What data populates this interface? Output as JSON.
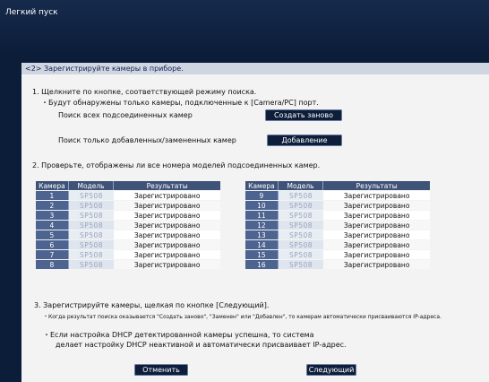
{
  "window": {
    "title": "Легкий пуск"
  },
  "section": {
    "header": "<2> Зарегистрируйте камеры в приборе."
  },
  "step1": {
    "heading": "1. Щелкните по кнопке, соответствующей режиму поиска.",
    "note": "・Будут обнаружены только камеры, подключенные к [Camera/PC] порт.",
    "search_all_label": "Поиск всех подсоединенных камер",
    "search_all_button": "Создать заново",
    "search_added_label": "Поиск только добавленных/замененных камер",
    "search_added_button": "Добавление"
  },
  "step2": {
    "heading": "2. Проверьте, отображены ли все номера моделей подсоединенных камер.",
    "columns": [
      "Камера",
      "Модель",
      "Результаты"
    ],
    "left_rows": [
      {
        "num": "1",
        "model": "SP508",
        "result": "Зарегистрировано"
      },
      {
        "num": "2",
        "model": "SP508",
        "result": "Зарегистрировано"
      },
      {
        "num": "3",
        "model": "SP508",
        "result": "Зарегистрировано"
      },
      {
        "num": "4",
        "model": "SP508",
        "result": "Зарегистрировано"
      },
      {
        "num": "5",
        "model": "SP508",
        "result": "Зарегистрировано"
      },
      {
        "num": "6",
        "model": "SP508",
        "result": "Зарегистрировано"
      },
      {
        "num": "7",
        "model": "SP508",
        "result": "Зарегистрировано"
      },
      {
        "num": "8",
        "model": "SP508",
        "result": "Зарегистрировано"
      }
    ],
    "right_rows": [
      {
        "num": "9",
        "model": "SP508",
        "result": "Зарегистрировано"
      },
      {
        "num": "10",
        "model": "SP508",
        "result": "Зарегистрировано"
      },
      {
        "num": "11",
        "model": "SP508",
        "result": "Зарегистрировано"
      },
      {
        "num": "12",
        "model": "SP508",
        "result": "Зарегистрировано"
      },
      {
        "num": "13",
        "model": "SP508",
        "result": "Зарегистрировано"
      },
      {
        "num": "14",
        "model": "SP508",
        "result": "Зарегистрировано"
      },
      {
        "num": "15",
        "model": "SP508",
        "result": "Зарегистрировано"
      },
      {
        "num": "16",
        "model": "SP508",
        "result": "Зарегистрировано"
      }
    ]
  },
  "step3": {
    "heading": "3. Зарегистрируйте камеры, щелкая по кнопке [Следующий].",
    "note1": "・Когда результат поиска оказывается \"Создать заново\", \"Заменен\" или \"Добавлен\", то камерам автоматически присваиваются IP-адреса.",
    "note2_line1": "・Если настройка DHCP детектированной камеры успешна, то система",
    "note2_line2": "делает настройку DHCP неактивной и автоматически присваивает IP-адрес."
  },
  "footer": {
    "cancel": "Отменить",
    "next": "Следующий"
  },
  "colors": {
    "background": "#0c1d3a",
    "panel": "#f3f3f3",
    "table_header": "#3f5378",
    "button": "#0d1d3a"
  }
}
